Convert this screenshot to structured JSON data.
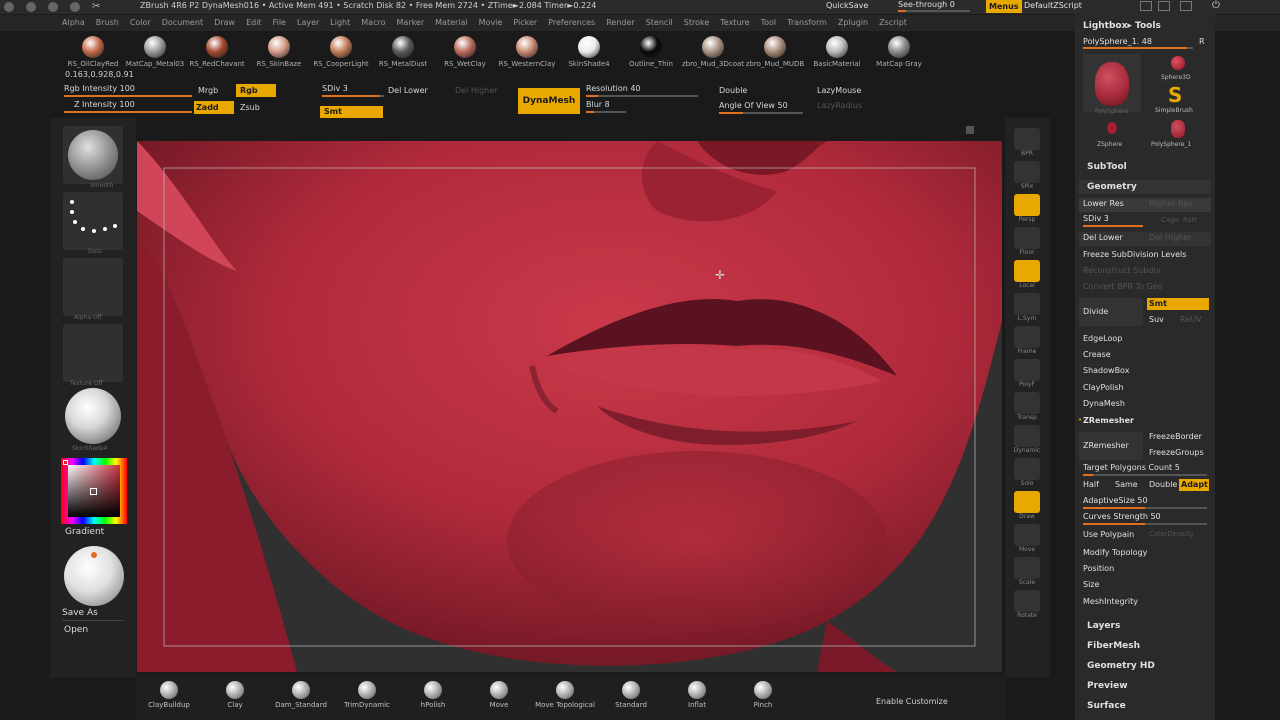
{
  "titlebar": {
    "text": "ZBrush 4R6 P2     DynaMesh016   • Active Mem 491 • Scratch Disk 82 • Free Mem 2724 • ZTime►2.084 Timer►0.224",
    "quicksave": "QuickSave",
    "see_through": "See-through  0",
    "menus": "Menus",
    "script": "DefaultZScript"
  },
  "menu_items": [
    "Alpha",
    "Brush",
    "Color",
    "Document",
    "Draw",
    "Edit",
    "File",
    "Layer",
    "Light",
    "Macro",
    "Marker",
    "Material",
    "Movie",
    "Picker",
    "Preferences",
    "Render",
    "Stencil",
    "Stroke",
    "Texture",
    "Tool",
    "Transform",
    "Zplugin",
    "Zscript"
  ],
  "materials": [
    {
      "label": "RS_OilClayRed",
      "color": "#c46a4a"
    },
    {
      "label": "MatCap_Metal03",
      "color": "#9a9a9a"
    },
    {
      "label": "RS_RedChavant",
      "color": "#a2482e"
    },
    {
      "label": "RS_SkinBaze",
      "color": "#d69a86"
    },
    {
      "label": "RS_CooperLight",
      "color": "#c27a58"
    },
    {
      "label": "RS_MetalDust",
      "color": "#5a5a5a"
    },
    {
      "label": "RS_WetClay",
      "color": "#b86a5a"
    },
    {
      "label": "RS_WesternClay",
      "color": "#c88870"
    },
    {
      "label": "SkinShade4",
      "color": "#ececec"
    },
    {
      "label": "Outline_Thin",
      "color": "#080808"
    },
    {
      "label": "zbro_Mud_3Dcoat",
      "color": "#a89080"
    },
    {
      "label": "zbro_Mud_MUDB",
      "color": "#a88a78"
    },
    {
      "label": "BasicMaterial",
      "color": "#b8b8b8"
    },
    {
      "label": "MatCap Gray",
      "color": "#8a8a8a"
    }
  ],
  "coords_readout": "0.163,0.928,0.91",
  "toolbar": {
    "rgb_intensity": "Rgb Intensity 100",
    "z_intensity": "Z Intensity 100",
    "mrgb": "Mrgb",
    "rgb": "Rgb",
    "zadd": "Zadd",
    "zsub": "Zsub",
    "sdiv": "SDiv 3",
    "del_lower": "Del Lower",
    "del_higher": "Del Higher",
    "smt": "Smt",
    "dynamesh": "DynaMesh",
    "resolution": "Resolution 40",
    "blur": "Blur 8",
    "double": "Double",
    "angle_of_view": "Angle Of View 50",
    "lazymouse": "LazyMouse",
    "lazyradius": "LazyRadius"
  },
  "left_panel": {
    "smooth_label": "Smooth",
    "dots_label": "Dots",
    "alpha_label": "Alpha Off",
    "texture_label": "Texture Off",
    "material_label": "SkinShade4",
    "gradient": "Gradient",
    "save_as": "Save As",
    "open": "Open"
  },
  "right_strip": [
    {
      "label": "BPR",
      "icon": "bpr-icon"
    },
    {
      "label": "SPix",
      "icon": "spix-icon"
    },
    {
      "label": "Persp",
      "icon": "persp-icon",
      "active": true
    },
    {
      "label": "Floor",
      "icon": "floor-icon"
    },
    {
      "label": "Local",
      "icon": "local-icon",
      "active": true
    },
    {
      "label": "L.Sym",
      "icon": "lsym-icon"
    },
    {
      "label": "Frame",
      "icon": "frame-icon"
    },
    {
      "label": "PolyF",
      "icon": "polyf-icon"
    },
    {
      "label": "Transp",
      "icon": "transp-icon"
    },
    {
      "label": "Dynamic",
      "icon": "dynamic-icon"
    },
    {
      "label": "Solo",
      "icon": "solo-icon"
    },
    {
      "label": "Draw",
      "icon": "draw-icon",
      "active": true
    },
    {
      "label": "Move",
      "icon": "move-icon"
    },
    {
      "label": "Scale",
      "icon": "scale-icon"
    },
    {
      "label": "Rotate",
      "icon": "rotate-icon"
    }
  ],
  "tool_panel": {
    "header": "Lightbox▸ Tools",
    "polysphere": "PolySphere_1. 48",
    "r": "R",
    "tools": [
      "PolySphere",
      "Sphere3D",
      "SimpleBrush",
      "ZSphere",
      "PolySphere_1"
    ],
    "subtool": "SubTool",
    "geometry": "Geometry",
    "lower_res": "Lower Res",
    "higher_res": "Higher Res",
    "sdiv": "SDiv 3",
    "cage": "Cage",
    "rstr": "Rstr",
    "del_lower": "Del Lower",
    "del_higher": "Del Higher",
    "freeze": "Freeze SubDivision Levels",
    "reconstruct": "Reconstruct Subdiv",
    "convert_bpr": "Convert BPR To Geo",
    "divide": "Divide",
    "smt": "Smt",
    "suv": "Suv",
    "rsmt": "ReUV",
    "edgeloop": "EdgeLoop",
    "crease": "Crease",
    "shadowbox": "ShadowBox",
    "claypolish": "ClayPolish",
    "dynamesh": "DynaMesh",
    "zremesher_header": "ZRemesher",
    "zremesher": "ZRemesher",
    "freeze_border": "FreezeBorder",
    "freeze_groups": "FreezeGroups",
    "target_poly": "Target Polygons Count 5",
    "half": "Half",
    "same": "Same",
    "double": "Double",
    "adapt": "Adapt",
    "adaptive_size": "AdaptiveSize 50",
    "curves_strength": "Curves Strength 50",
    "use_polypaint": "Use Polypain",
    "color_density": "ColorDensity",
    "modify_topology": "Modify Topology",
    "position": "Position",
    "size": "Size",
    "meshintegrity": "MeshIntegrity",
    "layers": "Layers",
    "fibermesh": "FiberMesh",
    "geometry_hd": "Geometry HD",
    "preview": "Preview",
    "surface": "Surface"
  },
  "brushes": [
    {
      "label": "ClayBuildup"
    },
    {
      "label": "Clay"
    },
    {
      "label": "Dam_Standard"
    },
    {
      "label": "TrimDynamic"
    },
    {
      "label": "hPolish"
    },
    {
      "label": "Move"
    },
    {
      "label": "Move Topological"
    },
    {
      "label": "Standard"
    },
    {
      "label": "Inflat"
    },
    {
      "label": "Pinch"
    }
  ],
  "enable_customize": "Enable Customize",
  "colors": {
    "accent": "#e8a800",
    "model_red": "#b8283a",
    "slider": "#e07020"
  }
}
